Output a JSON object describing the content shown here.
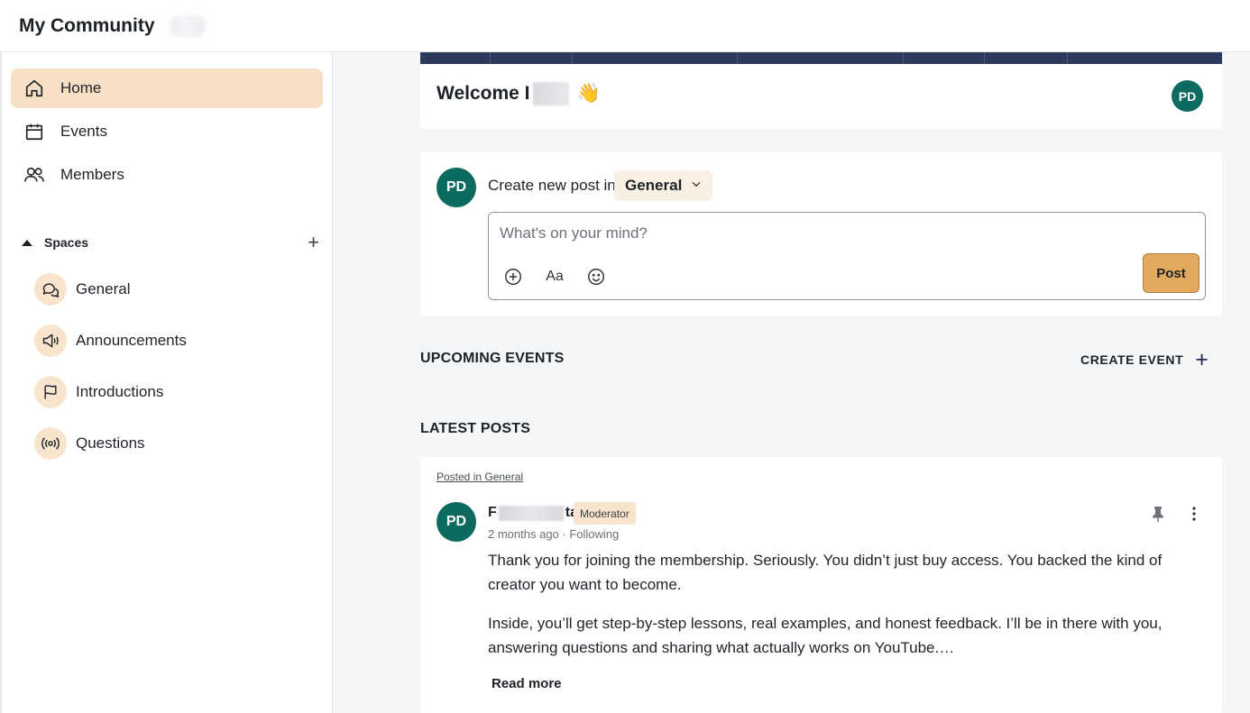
{
  "header": {
    "title": "My Community"
  },
  "sidebar": {
    "nav": [
      {
        "label": "Home",
        "icon": "home-icon",
        "active": true
      },
      {
        "label": "Events",
        "icon": "calendar-icon",
        "active": false
      },
      {
        "label": "Members",
        "icon": "members-icon",
        "active": false
      }
    ],
    "spaces_label": "Spaces",
    "add_space": "+",
    "spaces": [
      {
        "label": "General",
        "icon": "chat-bubbles-icon"
      },
      {
        "label": "Announcements",
        "icon": "megaphone-icon"
      },
      {
        "label": "Introductions",
        "icon": "flag-icon"
      },
      {
        "label": "Questions",
        "icon": "broadcast-icon"
      }
    ]
  },
  "welcome": {
    "text": "Welcome I",
    "emoji": "👋",
    "avatar_initials": "PD"
  },
  "composer": {
    "avatar_initials": "PD",
    "label": "Create new post in",
    "space": "General",
    "placeholder": "What's on your mind?",
    "format_label": "Aa",
    "post_button": "Post"
  },
  "events": {
    "title": "UPCOMING EVENTS",
    "create_label": "CREATE EVENT",
    "create_icon": "+"
  },
  "posts": {
    "title": "LATEST POSTS",
    "items": [
      {
        "posted_in": "Posted in General",
        "avatar_initials": "PD",
        "author_start": "F",
        "author_end": "ta",
        "badge": "Moderator",
        "meta": "2 months ago · Following",
        "paragraphs": [
          "Thank you for joining the membership. Seriously. You didn’t just buy access. You backed the kind of creator you want to become.",
          "Inside, you’ll get step-by-step lessons, real examples, and honest feedback. I’ll be in there with you, answering questions and sharing what actually works on YouTube.…"
        ],
        "read_more": "Read more"
      }
    ]
  },
  "colors": {
    "accent_active": "#f6dfc3",
    "avatar": "#0c6b5e",
    "post_button": "#e3a95f",
    "banner": "#2e3a5c"
  }
}
